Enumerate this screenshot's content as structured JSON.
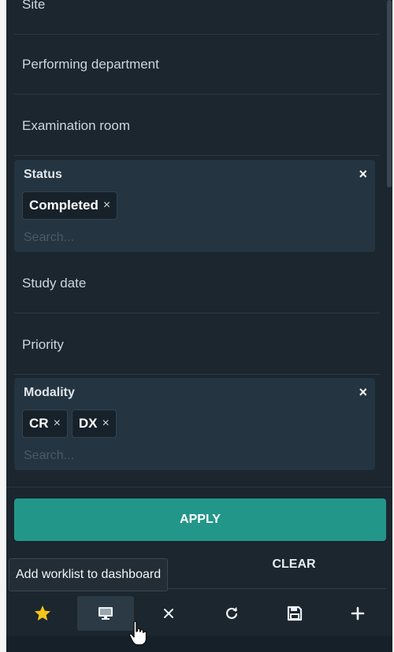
{
  "filters": {
    "site": {
      "label": "Site"
    },
    "performing_department": {
      "label": "Performing department"
    },
    "examination_room": {
      "label": "Examination room"
    },
    "status": {
      "label": "Status",
      "close_glyph": "×",
      "chips": [
        {
          "label": "Completed",
          "remove_glyph": "×"
        }
      ],
      "search_placeholder": "Search..."
    },
    "study_date": {
      "label": "Study date"
    },
    "priority": {
      "label": "Priority"
    },
    "modality": {
      "label": "Modality",
      "close_glyph": "×",
      "chips": [
        {
          "label": "CR",
          "remove_glyph": "×"
        },
        {
          "label": "DX",
          "remove_glyph": "×"
        }
      ],
      "search_placeholder": "Search..."
    }
  },
  "actions": {
    "apply_label": "APPLY",
    "clear_label": "CLEAR"
  },
  "tooltip": {
    "text": "Add worklist to dashboard"
  },
  "toolbar": {
    "buttons": [
      {
        "icon": "star-icon",
        "color": "#f5c518"
      },
      {
        "icon": "monitor-icon",
        "active": true
      },
      {
        "icon": "close-icon"
      },
      {
        "icon": "refresh-icon"
      },
      {
        "icon": "save-icon"
      },
      {
        "icon": "plus-icon"
      }
    ]
  },
  "colors": {
    "panel_bg": "#1b262f",
    "block_bg": "#243440",
    "accent": "#23968a",
    "star": "#f5c518"
  }
}
